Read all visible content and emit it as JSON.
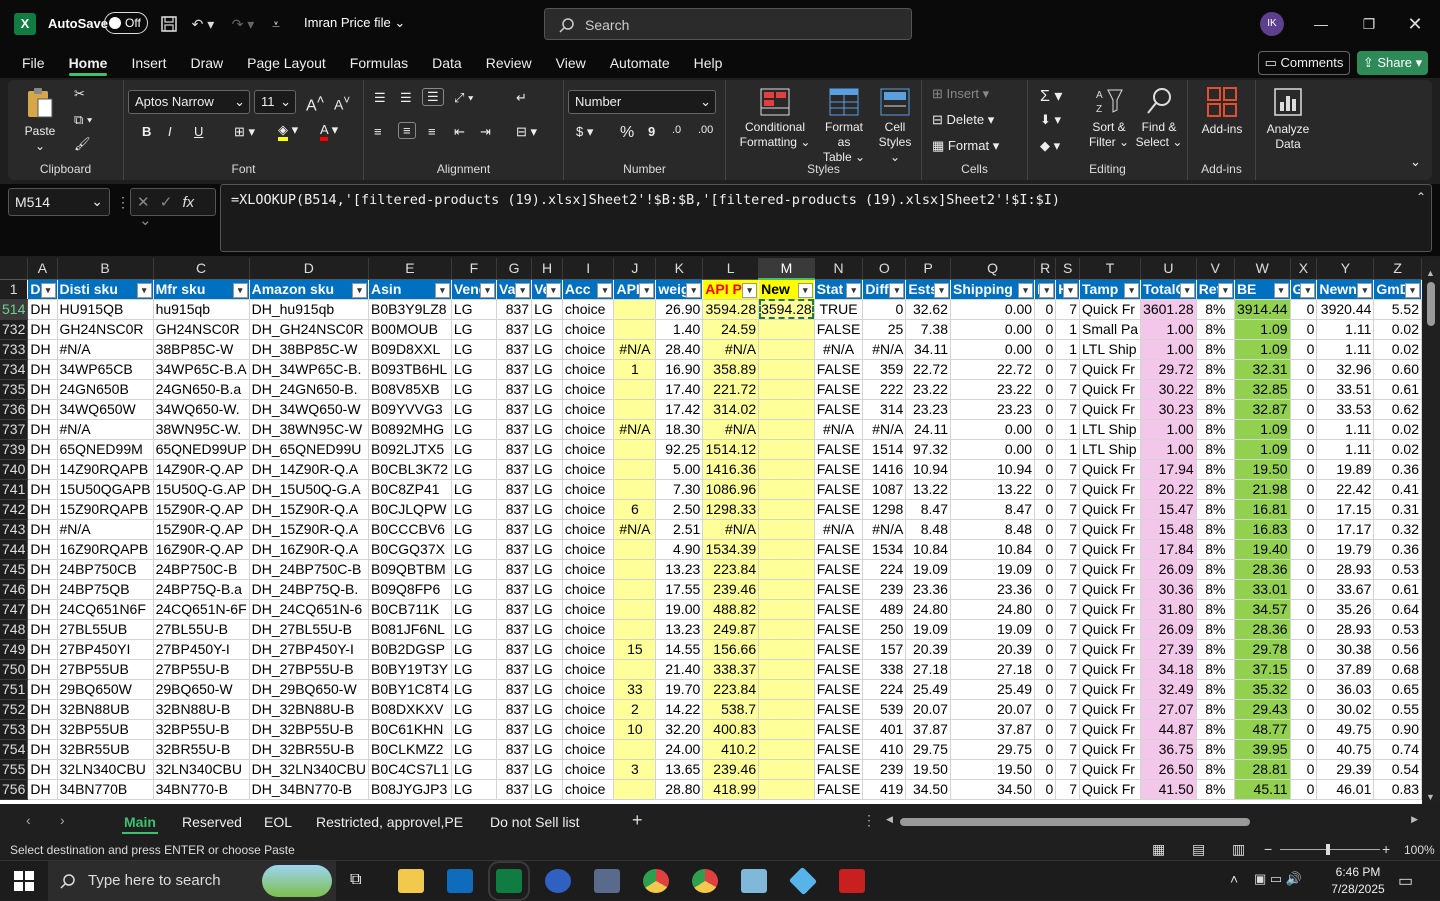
{
  "titlebar": {
    "autosave_label": "AutoSave",
    "autosave_state": "Off",
    "file_name": "Imran Price file",
    "search_placeholder": "Search",
    "user_initials": "IK"
  },
  "menu": {
    "items": [
      "File",
      "Home",
      "Insert",
      "Draw",
      "Page Layout",
      "Formulas",
      "Data",
      "Review",
      "View",
      "Automate",
      "Help"
    ],
    "active": "Home",
    "comments_label": "Comments",
    "share_label": "Share"
  },
  "ribbon": {
    "clipboard": {
      "paste": "Paste",
      "group": "Clipboard"
    },
    "font": {
      "name": "Aptos Narrow",
      "size": "11",
      "group": "Font",
      "bold": "B",
      "italic": "I",
      "underline": "U"
    },
    "alignment": {
      "group": "Alignment"
    },
    "number": {
      "format": "Number",
      "group": "Number",
      "currency": "$",
      "percent": "%",
      "comma": "9"
    },
    "styles": {
      "conditional": "Conditional",
      "conditional2": "Formatting",
      "format_as": "Format as",
      "format_as2": "Table",
      "cell": "Cell",
      "cell2": "Styles",
      "group": "Styles"
    },
    "cells": {
      "insert": "Insert",
      "delete": "Delete",
      "format": "Format",
      "group": "Cells"
    },
    "editing": {
      "sort": "Sort &",
      "sort2": "Filter",
      "find": "Find &",
      "find2": "Select",
      "group": "Editing"
    },
    "addins": {
      "addins": "Add-ins",
      "group": "Add-ins",
      "analyze": "Analyze",
      "analyze2": "Data"
    }
  },
  "formula": {
    "name_box": "M514",
    "fx": "fx",
    "content": "=XLOOKUP(B514,'[filtered-products (19).xlsx]Sheet2'!$B:$B,'[filtered-products (19).xlsx]Sheet2'!$I:$I)"
  },
  "grid": {
    "columns": [
      "A",
      "B",
      "C",
      "D",
      "E",
      "F",
      "G",
      "H",
      "I",
      "J",
      "K",
      "L",
      "M",
      "N",
      "O",
      "P",
      "Q",
      "R",
      "S",
      "T",
      "U",
      "V",
      "W",
      "X",
      "Y",
      "Z"
    ],
    "selected_column": "M",
    "header_row_number": "1",
    "headers": [
      "D",
      "Disti sku",
      "Mfr sku",
      "Amazon sku",
      "Asin",
      "Vend",
      "Va",
      "Ve",
      "Acc",
      "APIs",
      "weig",
      "API P",
      "New",
      "Stat",
      "Diff",
      "Ests",
      "Shipping",
      "In",
      "H",
      "Tamp",
      "TotalC",
      "Ret",
      "BE",
      "Gl",
      "Newn",
      "GmD"
    ],
    "rows": [
      {
        "n": "514",
        "cells": [
          "DH",
          "HU915QB",
          "hu915qb",
          "DH_hu915qb",
          "B0B3Y9LZ8",
          "LG",
          "837",
          "LG",
          "choice",
          "",
          "26.90",
          "3594.28",
          "3594.28",
          "TRUE",
          "0",
          "32.62",
          "0.00",
          "0",
          "7",
          "Quick Fr",
          "3601.28",
          "8%",
          "3914.44",
          "0",
          "3920.44",
          "5.52"
        ]
      },
      {
        "n": "732",
        "cells": [
          "DH",
          "GH24NSC0R",
          "GH24NSC0R",
          "DH_GH24NSC0R",
          "B00MOUB",
          "LG",
          "837",
          "LG",
          "choice",
          "",
          "1.40",
          "24.59",
          "",
          "FALSE",
          "25",
          "7.38",
          "0.00",
          "0",
          "1",
          "Small Pa",
          "1.00",
          "8%",
          "1.09",
          "0",
          "1.11",
          "0.02"
        ]
      },
      {
        "n": "733",
        "cells": [
          "DH",
          "#N/A",
          "38BP85C-W",
          "DH_38BP85C-W",
          "B09D8XXL",
          "LG",
          "837",
          "LG",
          "choice",
          "#N/A",
          "28.40",
          "#N/A",
          "",
          "#N/A",
          "#N/A",
          "34.11",
          "0.00",
          "0",
          "1",
          "LTL Ship",
          "1.00",
          "8%",
          "1.09",
          "0",
          "1.11",
          "0.02"
        ]
      },
      {
        "n": "734",
        "cells": [
          "DH",
          "34WP65CB",
          "34WP65C-B.A",
          "DH_34WP65C-B.",
          "B093TB6HL",
          "LG",
          "837",
          "LG",
          "choice",
          "1",
          "16.90",
          "358.89",
          "",
          "FALSE",
          "359",
          "22.72",
          "22.72",
          "0",
          "7",
          "Quick Fr",
          "29.72",
          "8%",
          "32.31",
          "0",
          "32.96",
          "0.60"
        ]
      },
      {
        "n": "735",
        "cells": [
          "DH",
          "24GN650B",
          "24GN650-B.a",
          "DH_24GN650-B.",
          "B08V85XB",
          "LG",
          "837",
          "LG",
          "choice",
          "",
          "17.40",
          "221.72",
          "",
          "FALSE",
          "222",
          "23.22",
          "23.22",
          "0",
          "7",
          "Quick Fr",
          "30.22",
          "8%",
          "32.85",
          "0",
          "33.51",
          "0.61"
        ]
      },
      {
        "n": "736",
        "cells": [
          "DH",
          "34WQ650W",
          "34WQ650-W.",
          "DH_34WQ650-W",
          "B09YVVG3",
          "LG",
          "837",
          "LG",
          "choice",
          "",
          "17.42",
          "314.02",
          "",
          "FALSE",
          "314",
          "23.23",
          "23.23",
          "0",
          "7",
          "Quick Fr",
          "30.23",
          "8%",
          "32.87",
          "0",
          "33.53",
          "0.62"
        ]
      },
      {
        "n": "737",
        "cells": [
          "DH",
          "#N/A",
          "38WN95C-W.",
          "DH_38WN95C-W",
          "B0892MHG",
          "LG",
          "837",
          "LG",
          "choice",
          "#N/A",
          "18.30",
          "#N/A",
          "",
          "#N/A",
          "#N/A",
          "24.11",
          "0.00",
          "0",
          "1",
          "LTL Ship",
          "1.00",
          "8%",
          "1.09",
          "0",
          "1.11",
          "0.02"
        ]
      },
      {
        "n": "739",
        "cells": [
          "DH",
          "65QNED99M",
          "65QNED99UP",
          "DH_65QNED99U",
          "B092LJTX5",
          "LG",
          "837",
          "LG",
          "choice",
          "",
          "92.25",
          "1514.12",
          "",
          "FALSE",
          "1514",
          "97.32",
          "0.00",
          "0",
          "1",
          "LTL Ship",
          "1.00",
          "8%",
          "1.09",
          "0",
          "1.11",
          "0.02"
        ]
      },
      {
        "n": "740",
        "cells": [
          "DH",
          "14Z90RQAPB",
          "14Z90R-Q.AP",
          "DH_14Z90R-Q.A",
          "B0CBL3K72",
          "LG",
          "837",
          "LG",
          "choice",
          "",
          "5.00",
          "1416.36",
          "",
          "FALSE",
          "1416",
          "10.94",
          "10.94",
          "0",
          "7",
          "Quick Fr",
          "17.94",
          "8%",
          "19.50",
          "0",
          "19.89",
          "0.36"
        ]
      },
      {
        "n": "741",
        "cells": [
          "DH",
          "15U50QGAPB",
          "15U50Q-G.AP",
          "DH_15U50Q-G.A",
          "B0C8ZP41",
          "LG",
          "837",
          "LG",
          "choice",
          "",
          "7.30",
          "1086.96",
          "",
          "FALSE",
          "1087",
          "13.22",
          "13.22",
          "0",
          "7",
          "Quick Fr",
          "20.22",
          "8%",
          "21.98",
          "0",
          "22.42",
          "0.41"
        ]
      },
      {
        "n": "742",
        "cells": [
          "DH",
          "15Z90RQAPB",
          "15Z90R-Q.AP",
          "DH_15Z90R-Q.A",
          "B0CJLQPW",
          "LG",
          "837",
          "LG",
          "choice",
          "6",
          "2.50",
          "1298.33",
          "",
          "FALSE",
          "1298",
          "8.47",
          "8.47",
          "0",
          "7",
          "Quick Fr",
          "15.47",
          "8%",
          "16.81",
          "0",
          "17.15",
          "0.31"
        ]
      },
      {
        "n": "743",
        "cells": [
          "DH",
          "#N/A",
          "15Z90R-Q.AP",
          "DH_15Z90R-Q.A",
          "B0CCCBV6",
          "LG",
          "837",
          "LG",
          "choice",
          "#N/A",
          "2.51",
          "#N/A",
          "",
          "#N/A",
          "#N/A",
          "8.48",
          "8.48",
          "0",
          "7",
          "Quick Fr",
          "15.48",
          "8%",
          "16.83",
          "0",
          "17.17",
          "0.32"
        ]
      },
      {
        "n": "744",
        "cells": [
          "DH",
          "16Z90RQAPB",
          "16Z90R-Q.AP",
          "DH_16Z90R-Q.A",
          "B0CGQ37X",
          "LG",
          "837",
          "LG",
          "choice",
          "",
          "4.90",
          "1534.39",
          "",
          "FALSE",
          "1534",
          "10.84",
          "10.84",
          "0",
          "7",
          "Quick Fr",
          "17.84",
          "8%",
          "19.40",
          "0",
          "19.79",
          "0.36"
        ]
      },
      {
        "n": "745",
        "cells": [
          "DH",
          "24BP750CB",
          "24BP750C-B",
          "DH_24BP750C-B",
          "B09QBTBM",
          "LG",
          "837",
          "LG",
          "choice",
          "",
          "13.23",
          "223.84",
          "",
          "FALSE",
          "224",
          "19.09",
          "19.09",
          "0",
          "7",
          "Quick Fr",
          "26.09",
          "8%",
          "28.36",
          "0",
          "28.93",
          "0.53"
        ]
      },
      {
        "n": "746",
        "cells": [
          "DH",
          "24BP75QB",
          "24BP75Q-B.a",
          "DH_24BP75Q-B.",
          "B09Q8FP6",
          "LG",
          "837",
          "LG",
          "choice",
          "",
          "17.55",
          "239.46",
          "",
          "FALSE",
          "239",
          "23.36",
          "23.36",
          "0",
          "7",
          "Quick Fr",
          "30.36",
          "8%",
          "33.01",
          "0",
          "33.67",
          "0.61"
        ]
      },
      {
        "n": "747",
        "cells": [
          "DH",
          "24CQ651N6F",
          "24CQ651N-6F",
          "DH_24CQ651N-6",
          "B0CB711K",
          "LG",
          "837",
          "LG",
          "choice",
          "",
          "19.00",
          "488.82",
          "",
          "FALSE",
          "489",
          "24.80",
          "24.80",
          "0",
          "7",
          "Quick Fr",
          "31.80",
          "8%",
          "34.57",
          "0",
          "35.26",
          "0.64"
        ]
      },
      {
        "n": "748",
        "cells": [
          "DH",
          "27BL55UB",
          "27BL55U-B",
          "DH_27BL55U-B",
          "B081JF6NL",
          "LG",
          "837",
          "LG",
          "choice",
          "",
          "13.23",
          "249.87",
          "",
          "FALSE",
          "250",
          "19.09",
          "19.09",
          "0",
          "7",
          "Quick Fr",
          "26.09",
          "8%",
          "28.36",
          "0",
          "28.93",
          "0.53"
        ]
      },
      {
        "n": "749",
        "cells": [
          "DH",
          "27BP450YI",
          "27BP450Y-I",
          "DH_27BP450Y-I",
          "B0B2DGSP",
          "LG",
          "837",
          "LG",
          "choice",
          "15",
          "14.55",
          "156.66",
          "",
          "FALSE",
          "157",
          "20.39",
          "20.39",
          "0",
          "7",
          "Quick Fr",
          "27.39",
          "8%",
          "29.78",
          "0",
          "30.38",
          "0.56"
        ]
      },
      {
        "n": "750",
        "cells": [
          "DH",
          "27BP55UB",
          "27BP55U-B",
          "DH_27BP55U-B",
          "B0BY19T3Y",
          "LG",
          "837",
          "LG",
          "choice",
          "",
          "21.40",
          "338.37",
          "",
          "FALSE",
          "338",
          "27.18",
          "27.18",
          "0",
          "7",
          "Quick Fr",
          "34.18",
          "8%",
          "37.15",
          "0",
          "37.89",
          "0.68"
        ]
      },
      {
        "n": "751",
        "cells": [
          "DH",
          "29BQ650W",
          "29BQ650-W",
          "DH_29BQ650-W",
          "B0BY1C8T4",
          "LG",
          "837",
          "LG",
          "choice",
          "33",
          "19.70",
          "223.84",
          "",
          "FALSE",
          "224",
          "25.49",
          "25.49",
          "0",
          "7",
          "Quick Fr",
          "32.49",
          "8%",
          "35.32",
          "0",
          "36.03",
          "0.65"
        ]
      },
      {
        "n": "752",
        "cells": [
          "DH",
          "32BN88UB",
          "32BN88U-B",
          "DH_32BN88U-B",
          "B08DXKXV",
          "LG",
          "837",
          "LG",
          "choice",
          "2",
          "14.22",
          "538.7",
          "",
          "FALSE",
          "539",
          "20.07",
          "20.07",
          "0",
          "7",
          "Quick Fr",
          "27.07",
          "8%",
          "29.43",
          "0",
          "30.02",
          "0.55"
        ]
      },
      {
        "n": "753",
        "cells": [
          "DH",
          "32BP55UB",
          "32BP55U-B",
          "DH_32BP55U-B",
          "B0C61KHN",
          "LG",
          "837",
          "LG",
          "choice",
          "10",
          "32.20",
          "400.83",
          "",
          "FALSE",
          "401",
          "37.87",
          "37.87",
          "0",
          "7",
          "Quick Fr",
          "44.87",
          "8%",
          "48.77",
          "0",
          "49.75",
          "0.90"
        ]
      },
      {
        "n": "754",
        "cells": [
          "DH",
          "32BR55UB",
          "32BR55U-B",
          "DH_32BR55U-B",
          "B0CLKMZ2",
          "LG",
          "837",
          "LG",
          "choice",
          "",
          "24.00",
          "410.2",
          "",
          "FALSE",
          "410",
          "29.75",
          "29.75",
          "0",
          "7",
          "Quick Fr",
          "36.75",
          "8%",
          "39.95",
          "0",
          "40.75",
          "0.74"
        ]
      },
      {
        "n": "755",
        "cells": [
          "DH",
          "32LN340CBU",
          "32LN340CBU",
          "DH_32LN340CBU",
          "B0C4CS7L1",
          "LG",
          "837",
          "LG",
          "choice",
          "3",
          "13.65",
          "239.46",
          "",
          "FALSE",
          "239",
          "19.50",
          "19.50",
          "0",
          "7",
          "Quick Fr",
          "26.50",
          "8%",
          "28.81",
          "0",
          "29.39",
          "0.54"
        ]
      },
      {
        "n": "756",
        "cells": [
          "DH",
          "34BN770B",
          "34BN770-B",
          "DH_34BN770-B",
          "B08JYGJP3",
          "LG",
          "837",
          "LG",
          "choice",
          "",
          "28.80",
          "418.99",
          "",
          "FALSE",
          "419",
          "34.50",
          "34.50",
          "0",
          "7",
          "Quick Fr",
          "41.50",
          "8%",
          "45.11",
          "0",
          "46.01",
          "0.83"
        ]
      }
    ]
  },
  "sheets": {
    "tabs": [
      "Main",
      "Reserved",
      "EOL",
      "Restricted, approvel,PE",
      "Do not Sell list"
    ],
    "active": "Main",
    "add": "+"
  },
  "status": {
    "message": "Select destination and press ENTER or choose Paste",
    "zoom": "100%"
  },
  "taskbar": {
    "search_placeholder": "Type here to search",
    "time": "6:46 PM",
    "date": "7/28/2025"
  }
}
